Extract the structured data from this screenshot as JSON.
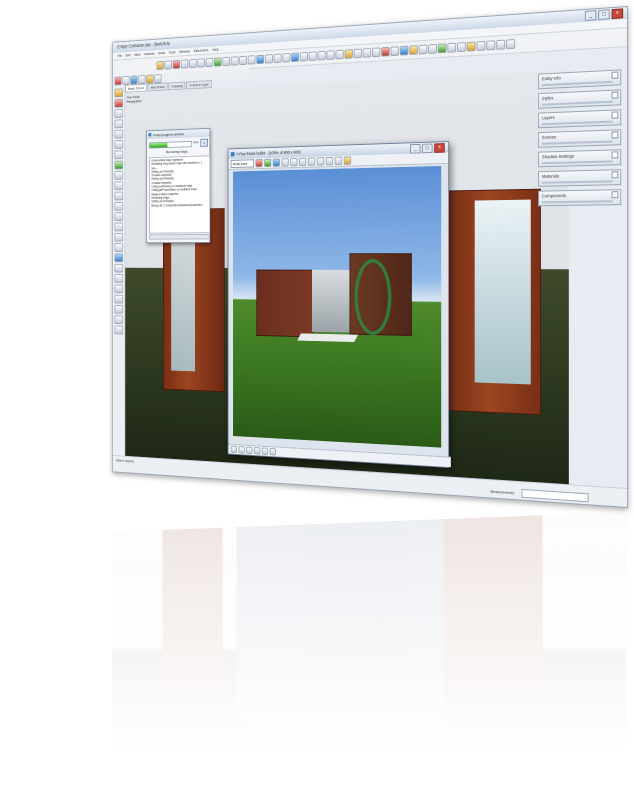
{
  "window": {
    "title": "Empty Container.skp - SketchUp",
    "menu": [
      "File",
      "Edit",
      "View",
      "Camera",
      "Draw",
      "Tools",
      "Window",
      "Extensions",
      "Help"
    ]
  },
  "scene_tabs": [
    "Basic Scene",
    "Mat Scene",
    "Creating",
    "X-Scene Light"
  ],
  "view_labels": {
    "line1": "Two Point",
    "line2": "Perspective"
  },
  "panels": [
    "Entity Info",
    "Styles",
    "Layers",
    "Scenes",
    "Shadow Settings",
    "Materials",
    "Components"
  ],
  "status": {
    "hint": "Select objects.",
    "measurements_label": "Measurements"
  },
  "progress_window": {
    "title": "V-Ray progress window",
    "percent": "0%",
    "progress_fraction": 0.42,
    "status": "Rendering image...",
    "log": [
      "Unimportable maps registered",
      "Rendering interpolation maps with resolution x 1 resu...",
      "Setting up 8 thread(s)",
      "Threads completed",
      "Setting up 8 thread(s)",
      "Threads completed",
      "Calling endFrame() on irradiance maps",
      "Calling preFrame(false) on irradiance maps",
      "Image prepass completed",
      "Rendering image...",
      "Setting up 8 thread(s)",
      "Bitmap file 'C:/Users/richard/Desktop/QuickStart..."
    ]
  },
  "frame_buffer": {
    "title": "V-Ray frame buffer - [100% of 800 x 600]",
    "channel": "RGB color"
  },
  "icons": {
    "close": "close-icon",
    "minimize": "minimize-icon",
    "maximize": "maximize-icon"
  },
  "colors": {
    "container_rust": "#9c4520",
    "ground_green": "#3e4a2a",
    "progress_green": "#2fa41c",
    "ring_green": "#1f9a34"
  }
}
